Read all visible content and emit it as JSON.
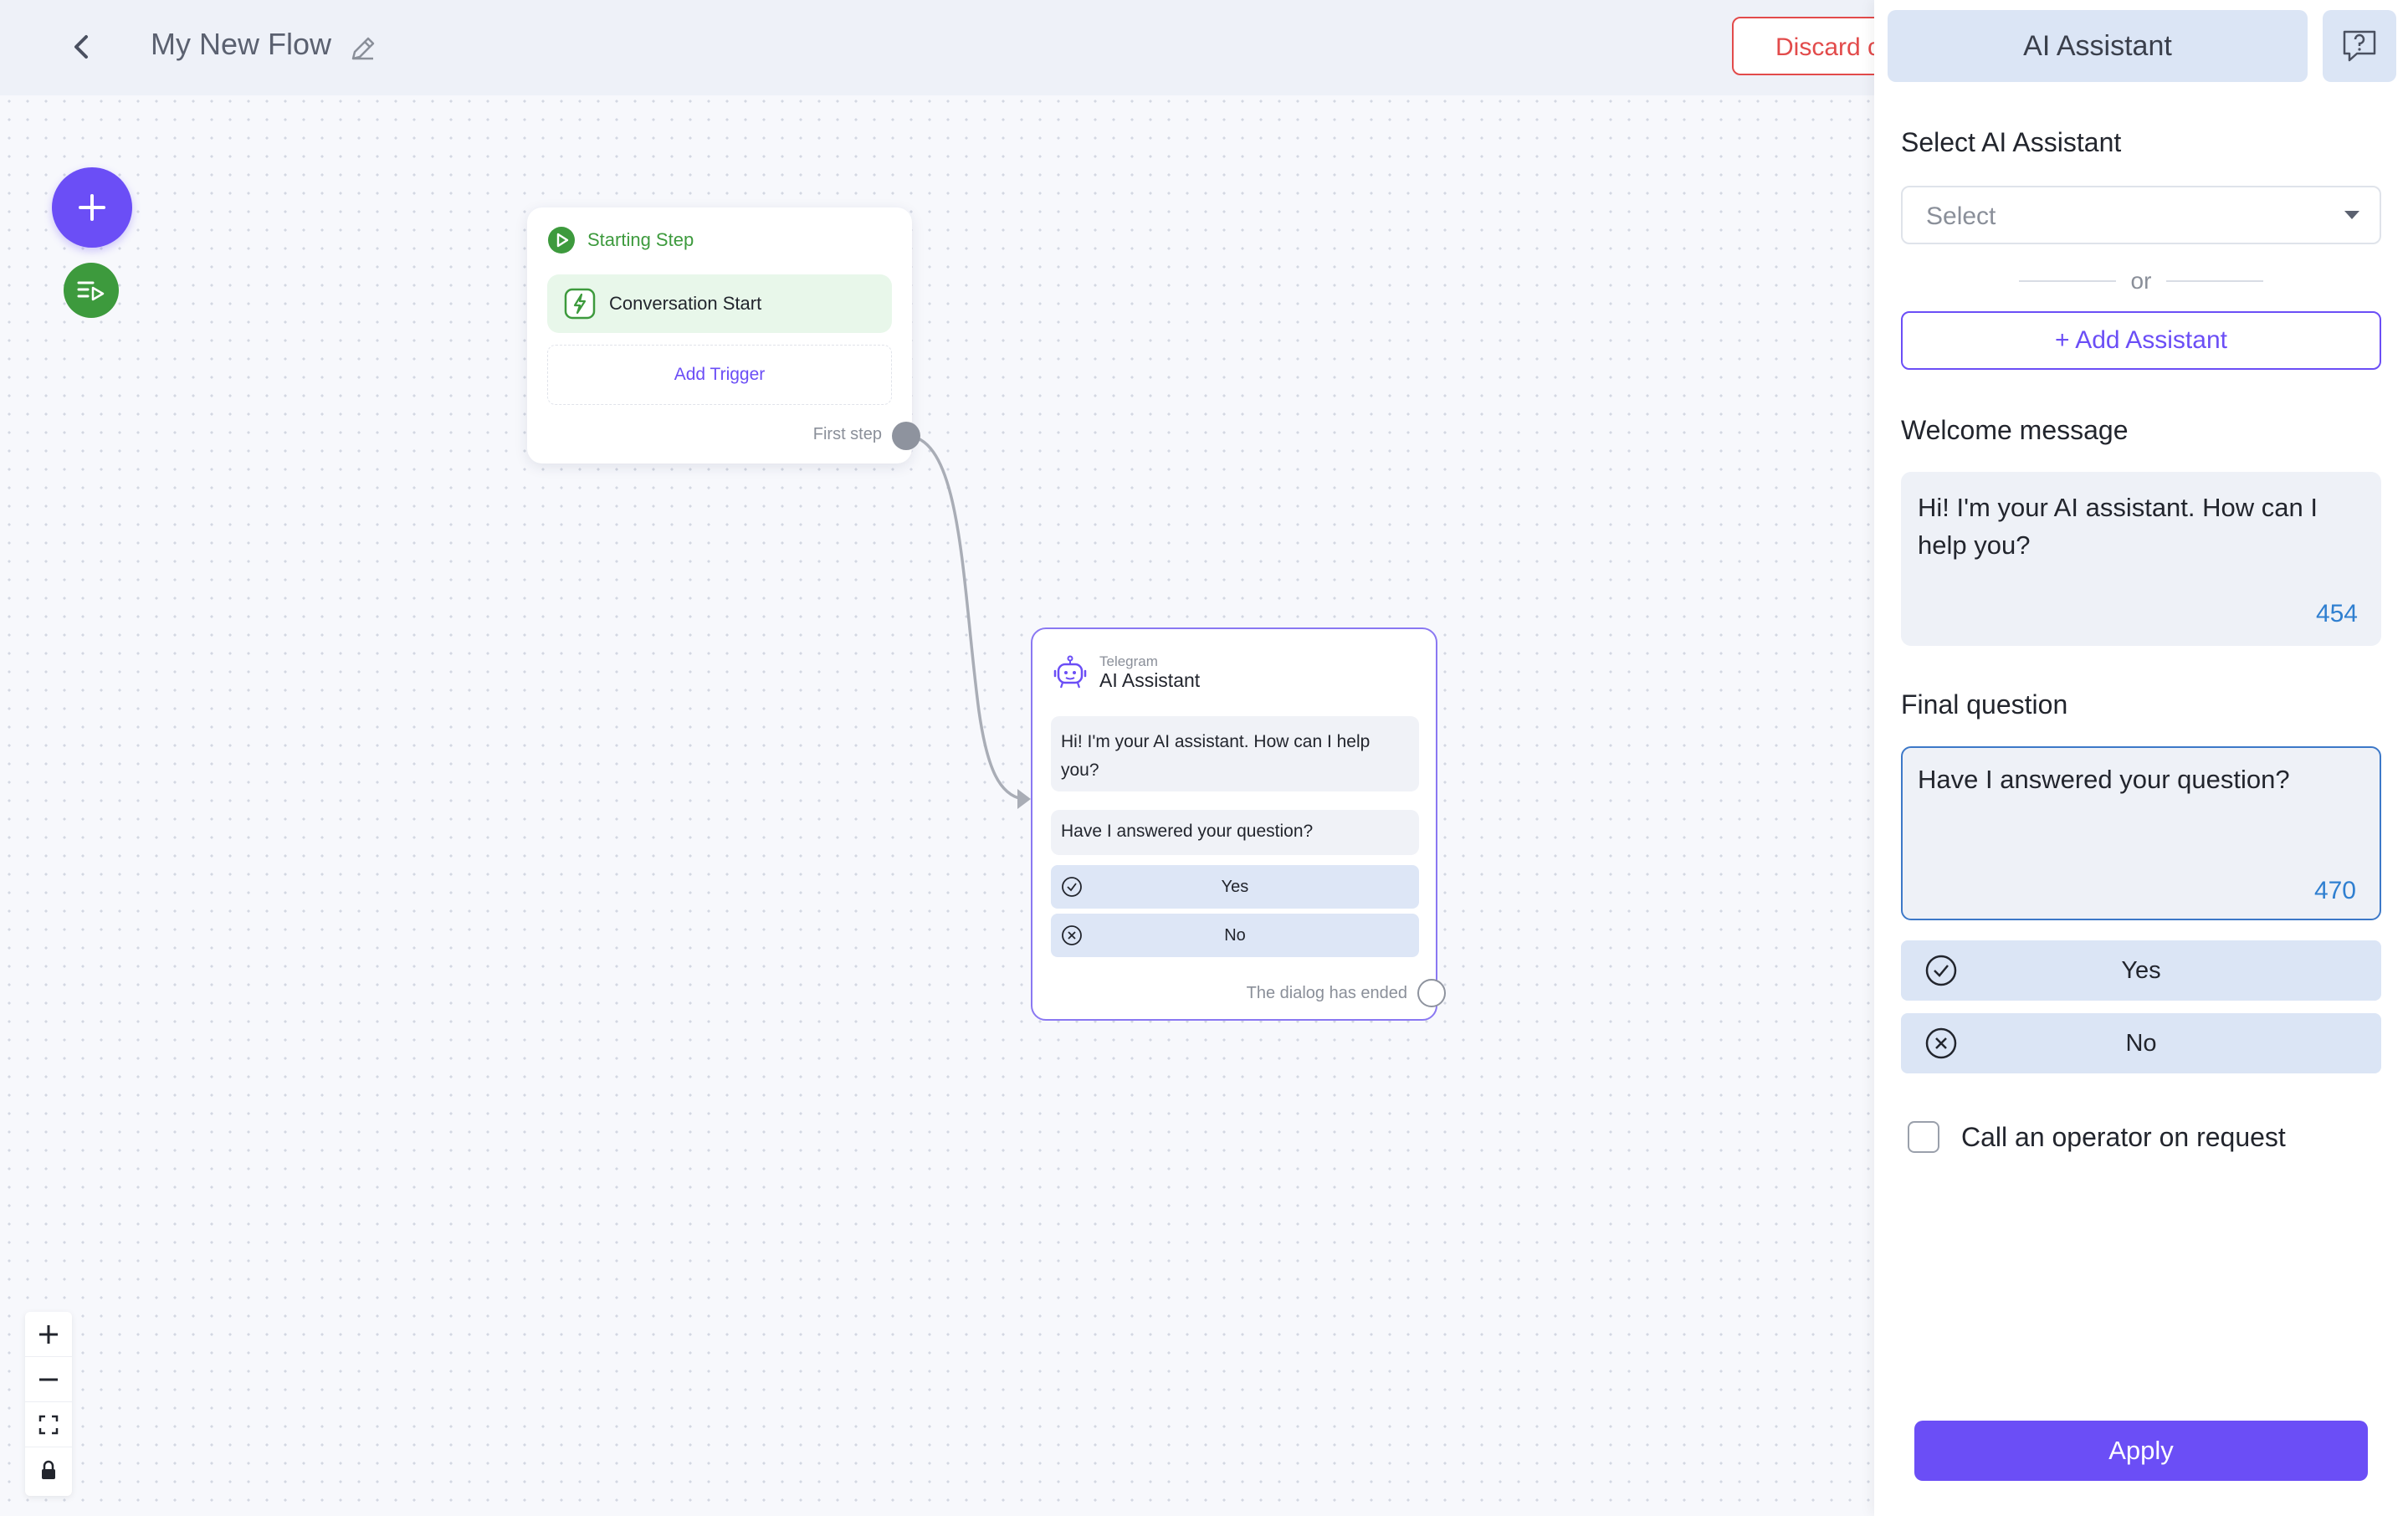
{
  "header": {
    "flow_title": "My New Flow",
    "discard_label": "Discard c"
  },
  "start_node": {
    "title": "Starting Step",
    "trigger_label": "Conversation Start",
    "add_trigger_label": "Add Trigger",
    "port_label": "First step"
  },
  "ai_node": {
    "channel": "Telegram",
    "title": "AI Assistant",
    "welcome_message": "Hi! I'm your AI assistant. How can I help you?",
    "final_question": "Have I answered your question?",
    "answers": [
      "Yes",
      "No"
    ],
    "end_label": "The dialog has ended"
  },
  "panel": {
    "tab_title": "AI Assistant",
    "select_label": "Select AI Assistant",
    "select_placeholder": "Select",
    "or_label": "or",
    "add_assistant_label": "+ Add Assistant",
    "welcome_label": "Welcome message",
    "welcome_text": "Hi! I'm your AI assistant. How can I help you?",
    "welcome_count": "454",
    "final_label": "Final question",
    "final_text": "Have I answered your question?",
    "final_count": "470",
    "answers": [
      "Yes",
      "No"
    ],
    "operator_label": "Call an operator on request",
    "operator_checked": false,
    "apply_label": "Apply"
  },
  "colors": {
    "accent": "#6b4ef6",
    "success": "#3d9a3d",
    "danger": "#e24b4b",
    "link": "#2f7fd0"
  },
  "icons": {
    "back": "chevron-left-icon",
    "edit": "pencil-icon",
    "add": "plus-icon",
    "list": "list-play-icon",
    "start": "play-circle-icon",
    "trigger": "lightning-icon",
    "bot": "robot-icon",
    "check": "check-circle-icon",
    "cross": "x-circle-icon",
    "help": "help-chat-icon",
    "zoom_in": "zoom-in-icon",
    "zoom_out": "zoom-out-icon",
    "fit": "fit-view-icon",
    "lock": "lock-icon"
  }
}
